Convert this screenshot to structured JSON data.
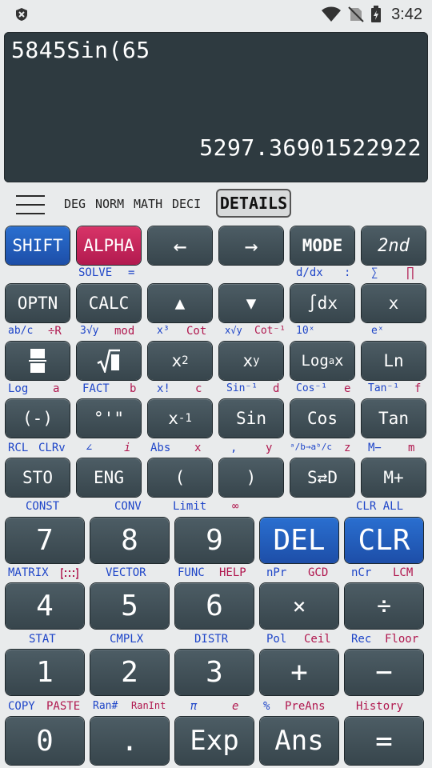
{
  "status_bar": {
    "time": "3:42"
  },
  "display": {
    "expression": "5845Sin(65",
    "result": "5297.36901522922"
  },
  "mode_bar": {
    "modes": [
      "DEG",
      "NORM",
      "MATH",
      "DECI"
    ],
    "details_label": "DETAILS"
  },
  "row1": {
    "keys": [
      "SHIFT",
      "ALPHA",
      "←",
      "→",
      "MODE",
      "2nd"
    ],
    "labels": {
      "solve": "SOLVE",
      "eq": "=",
      "ddx": "d/dx",
      "colon": ":",
      "sum": "∑",
      "prod": "∏"
    }
  },
  "row2": {
    "keys": [
      "OPTN",
      "CALC",
      "▲",
      "▼",
      "∫dx",
      "x"
    ],
    "labels": [
      "ab/c",
      "÷R",
      "3√y",
      "mod",
      "x³",
      "Cot",
      "x√y",
      "Cot⁻¹",
      "10ˣ",
      "eˣ"
    ]
  },
  "row3": {
    "keys": [
      "",
      "√",
      "x2",
      "xy",
      "Logₐx",
      "Ln"
    ],
    "labels": [
      "Log",
      "a",
      "FACT",
      "b",
      "x!",
      "c",
      "Sin⁻¹",
      "d",
      "Cos⁻¹",
      "e",
      "Tan⁻¹",
      "f"
    ]
  },
  "row4": {
    "keys": [
      "(-)",
      "°'\"",
      "x-1",
      "Sin",
      "Cos",
      "Tan"
    ],
    "labels": [
      "RCL",
      "CLRv",
      "∠",
      "i",
      "Abs",
      "x",
      ",",
      "y",
      "ᵃ/b→aᵇ/c",
      "z",
      "M−",
      "m"
    ]
  },
  "row5": {
    "keys": [
      "STO",
      "ENG",
      "(",
      ")",
      "S⇄D",
      "M+"
    ],
    "labels": [
      "CONST",
      "CONV",
      "Limit",
      "∞",
      "CLR ALL"
    ]
  },
  "row6": {
    "keys": [
      "7",
      "8",
      "9",
      "DEL",
      "CLR"
    ],
    "labels": [
      "MATRIX",
      "VECTOR",
      "FUNC",
      "HELP",
      "nPr",
      "GCD",
      "nCr",
      "LCM"
    ]
  },
  "row7": {
    "keys": [
      "4",
      "5",
      "6",
      "×",
      "÷"
    ],
    "labels": [
      "STAT",
      "CMPLX",
      "DISTR",
      "Pol",
      "Ceil",
      "Rec",
      "Floor"
    ]
  },
  "row8": {
    "keys": [
      "1",
      "2",
      "3",
      "+",
      "−"
    ],
    "labels": [
      "COPY",
      "PASTE",
      "Ran#",
      "RanInt",
      "π",
      "e",
      "%",
      "PreAns",
      "History"
    ]
  },
  "row9": {
    "keys": [
      "0",
      ".",
      "Exp",
      "Ans",
      "="
    ]
  },
  "colors": {
    "blue_label": "#1e45c8",
    "red_label": "#b0174e",
    "key_dark": "#3f4e55",
    "key_blue": "#1d4ea8",
    "key_red": "#c21f57",
    "display_bg": "#2e3a40"
  }
}
